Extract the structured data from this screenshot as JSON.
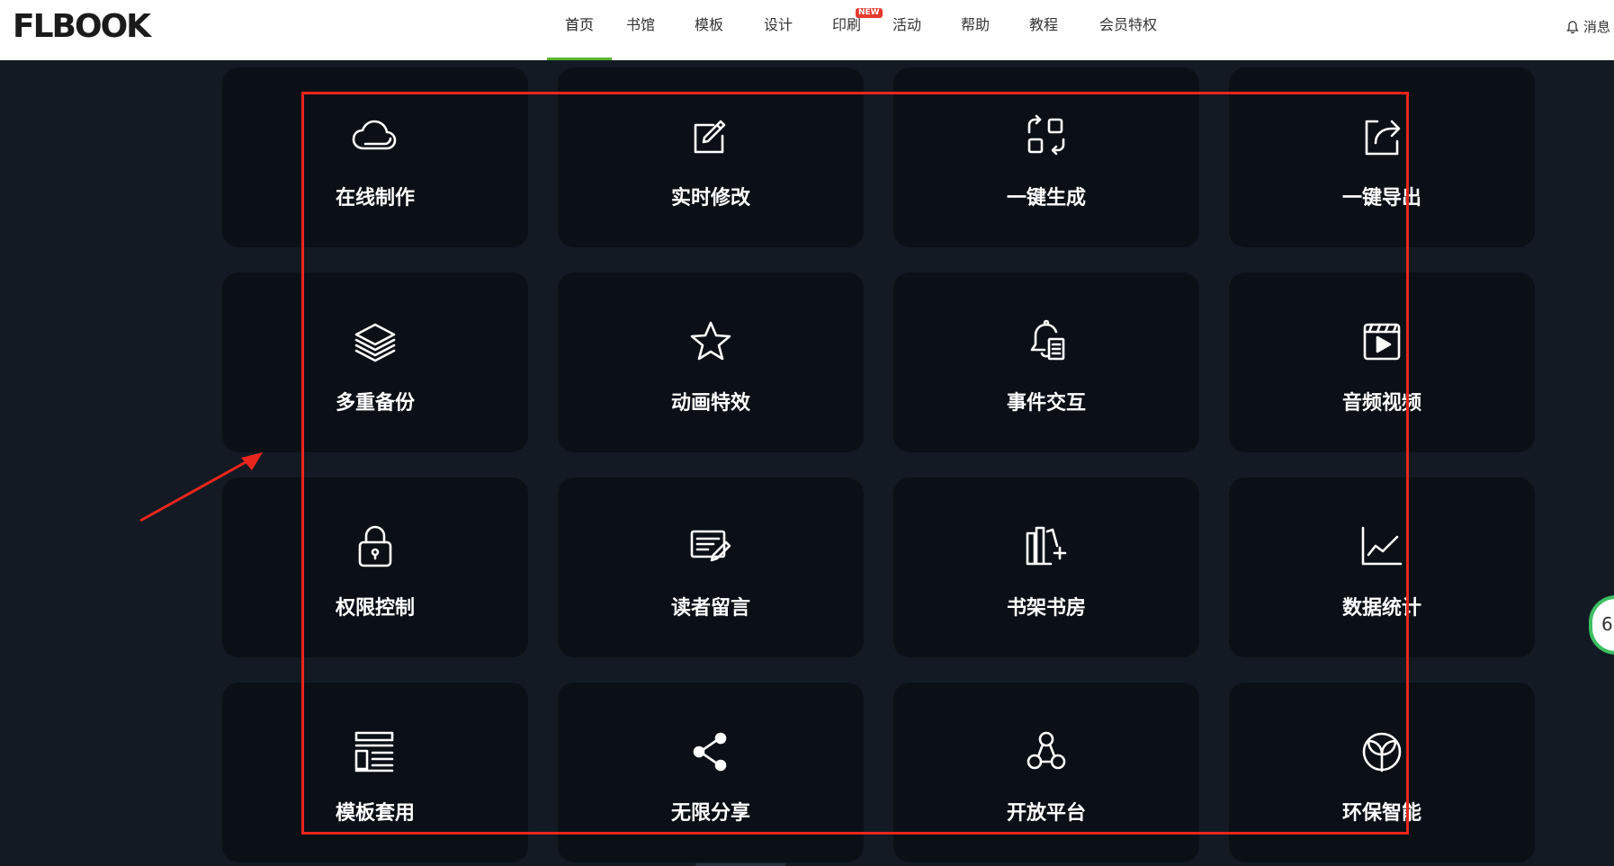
{
  "header": {
    "logo_text": "FLBOOK",
    "nav": [
      {
        "label": "首页",
        "active": true
      },
      {
        "label": "书馆"
      },
      {
        "label": "模板"
      },
      {
        "label": "设计"
      },
      {
        "label": "印刷",
        "badge": "NEW"
      },
      {
        "label": "活动"
      },
      {
        "label": "帮助"
      },
      {
        "label": "教程"
      },
      {
        "label": "会员特权"
      }
    ],
    "messages_label": "消息"
  },
  "features": [
    {
      "label": "在线制作",
      "icon": "cloud-icon"
    },
    {
      "label": "实时修改",
      "icon": "edit-icon"
    },
    {
      "label": "一键生成",
      "icon": "generate-icon"
    },
    {
      "label": "一键导出",
      "icon": "export-icon"
    },
    {
      "label": "多重备份",
      "icon": "layers-icon"
    },
    {
      "label": "动画特效",
      "icon": "star-icon"
    },
    {
      "label": "事件交互",
      "icon": "bell-doc-icon"
    },
    {
      "label": "音频视频",
      "icon": "video-icon"
    },
    {
      "label": "权限控制",
      "icon": "lock-icon"
    },
    {
      "label": "读者留言",
      "icon": "comment-icon"
    },
    {
      "label": "书架书房",
      "icon": "bookshelf-icon"
    },
    {
      "label": "数据统计",
      "icon": "chart-icon"
    },
    {
      "label": "模板套用",
      "icon": "template-icon"
    },
    {
      "label": "无限分享",
      "icon": "share-icon"
    },
    {
      "label": "开放平台",
      "icon": "platform-icon"
    },
    {
      "label": "环保智能",
      "icon": "eco-icon"
    }
  ],
  "side_widget": {
    "text": "6"
  },
  "colors": {
    "accent": "#5ab52a",
    "badge": "#e63a2e",
    "frame": "#e8261d",
    "background": "#131a23",
    "card": "#0b1017"
  }
}
